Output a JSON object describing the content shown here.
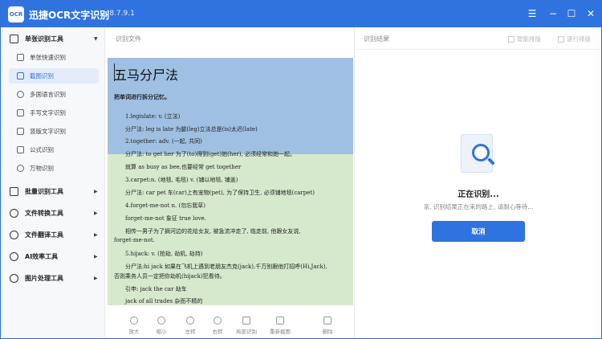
{
  "app": {
    "logo_text": "OCR",
    "title": "迅捷OCR文字识别",
    "version": "v8.7.9.1"
  },
  "window_controls": [
    "menu",
    "minimize",
    "maximize",
    "close"
  ],
  "sidebar": {
    "groups": [
      {
        "label": "单张识别工具",
        "expanded": true,
        "items": [
          {
            "label": "单张快速识别",
            "active": false
          },
          {
            "label": "截图识别",
            "active": true
          },
          {
            "label": "多国语言识别",
            "active": false
          },
          {
            "label": "手写文字识别",
            "active": false
          },
          {
            "label": "竖版文字识别",
            "active": false
          },
          {
            "label": "公式识别",
            "active": false
          },
          {
            "label": "万物识别",
            "active": false
          }
        ]
      },
      {
        "label": "批量识别工具"
      },
      {
        "label": "文件转换工具"
      },
      {
        "label": "文件翻译工具"
      },
      {
        "label": "AI效率工具"
      },
      {
        "label": "图片处理工具"
      }
    ]
  },
  "source_panel": {
    "title": "识别文件",
    "doc": {
      "title": "五马分尸法",
      "subtitle": "把单词进行拆分记忆。",
      "lines": [
        "1.legislate: v. (立法)",
        "分尸法: leg is late 为腿(leg)立法总是(is)太迟(late)",
        "2.together: adv. (一起, 共同)",
        "分尸法: to get her 为了(to)得到(get)她(her), 必须经常和她一起。",
        "就算 as busy as bee,也要经常 get together",
        "3.carpet:n. (地毯, 毛毯) v. (铺以地毯, 铺盖)",
        "分尸法: car pet 车(car)上有宠物(pet), 为了保持卫生, 必须铺地毯(carpet)",
        "4.forget-me-not n. (勿忘我草)",
        "forget-me-not 象征 true love.",
        "相传一男子为了摘河边的花给女友, 被急流冲走了, 临走前, 他跟女友说,",
        "forget-me-not.",
        "5.hijack: v. (抢劫, 劫机, 劫持)",
        "分尸法:hi jack 如果在飞机上遇到老朋友杰克(jack),千万别跟他打招呼(Hi,Jack),",
        "否则乘务人员一定把你劫机(hijack)犯看待。",
        "引申: jack the car 劫车",
        "jack of all trades 杂而不精的"
      ]
    },
    "toolbar": [
      {
        "label": "放大",
        "icon": "zoom-in-icon"
      },
      {
        "label": "缩小",
        "icon": "zoom-out-icon"
      },
      {
        "label": "左转",
        "icon": "rotate-left-icon"
      },
      {
        "label": "右转",
        "icon": "rotate-right-icon"
      },
      {
        "label": "局部识别",
        "icon": "partial-recognize-icon"
      },
      {
        "label": "重新截图",
        "icon": "retake-screenshot-icon"
      },
      {
        "label": "删除",
        "icon": "delete-icon"
      }
    ]
  },
  "result_panel": {
    "title": "识别结果",
    "smart_layout": "智能排版",
    "line_layout": "逐行排版",
    "status": "正在识别...",
    "hint": "亲, 识别结果正在来的路上, 请耐心等待...",
    "cancel": "取消"
  },
  "colors": {
    "accent": "#2f73e0",
    "selection": "#9fc0e2",
    "document_bg": "#d6e9cc"
  }
}
